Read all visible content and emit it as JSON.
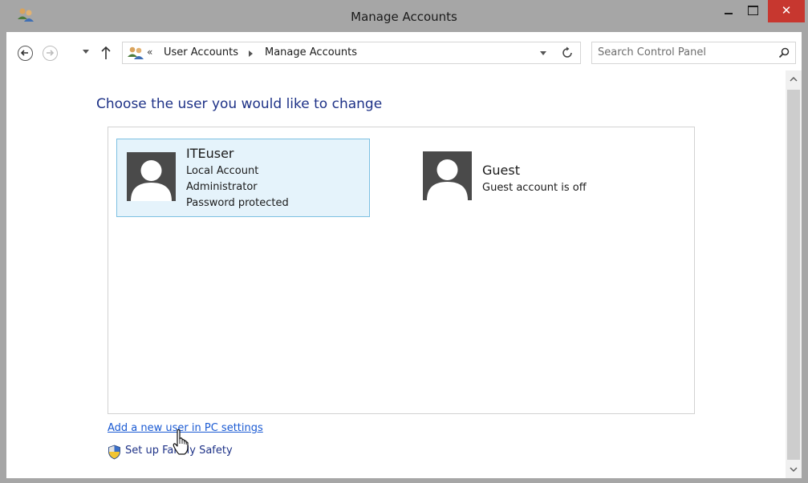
{
  "window": {
    "title": "Manage Accounts",
    "close_glyph": "✕"
  },
  "navigation": {
    "breadcrumb_overflow": "«",
    "breadcrumbs": [
      "User Accounts",
      "Manage Accounts"
    ],
    "search_placeholder": "Search Control Panel"
  },
  "main": {
    "heading": "Choose the user you would like to change",
    "accounts": [
      {
        "name": "ITEuser",
        "details": [
          "Local Account",
          "Administrator",
          "Password protected"
        ],
        "selected": true
      },
      {
        "name": "Guest",
        "details": [
          "Guest account is off"
        ],
        "selected": false
      }
    ],
    "add_user_link": "Add a new user in PC settings",
    "family_safety_link": "Set up Family Safety"
  },
  "colors": {
    "title_bar": "#a6a6a6",
    "close_button": "#c7372f",
    "heading": "#1e3287",
    "link": "#1a5ad3",
    "selected_card": "#e5f3fb",
    "selected_border": "#7cc0e2"
  },
  "icons": [
    "user-accounts-icon",
    "back-icon",
    "forward-icon",
    "up-arrow-icon",
    "refresh-icon",
    "search-icon",
    "shield-icon",
    "user-avatar-icon",
    "hand-cursor-icon"
  ]
}
